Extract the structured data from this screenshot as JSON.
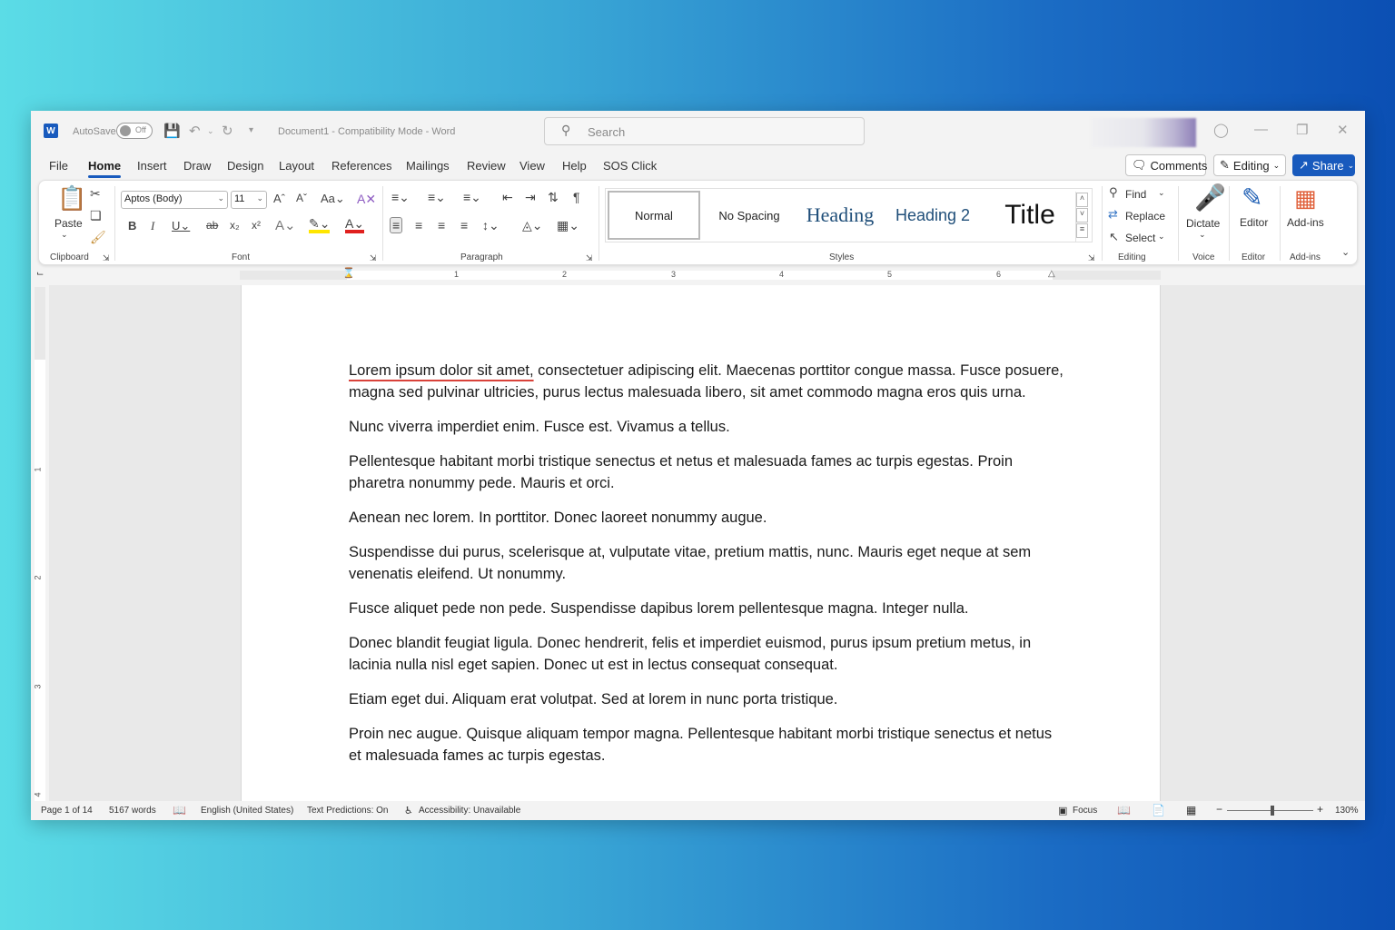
{
  "titlebar": {
    "autosave_label": "AutoSave",
    "autosave_state": "Off",
    "doc_title": "Document1  -  Compatibility Mode  -  Word",
    "search_placeholder": "Search"
  },
  "menu": {
    "tabs": [
      "File",
      "Home",
      "Insert",
      "Draw",
      "Design",
      "Layout",
      "References",
      "Mailings",
      "Review",
      "View",
      "Help",
      "SOS Click"
    ],
    "active_tab": "Home",
    "comments_label": "Comments",
    "editing_label": "Editing",
    "share_label": "Share"
  },
  "ribbon": {
    "clipboard": {
      "paste_label": "Paste",
      "group_label": "Clipboard"
    },
    "font": {
      "font_name": "Aptos (Body)",
      "font_size": "11",
      "group_label": "Font"
    },
    "paragraph": {
      "group_label": "Paragraph"
    },
    "styles": {
      "items": [
        "Normal",
        "No Spacing",
        "Heading 1",
        "Heading 2",
        "Title"
      ],
      "h1_visible": "Heading",
      "group_label": "Styles"
    },
    "editing": {
      "find": "Find",
      "replace": "Replace",
      "select": "Select",
      "group_label": "Editing"
    },
    "voice": {
      "dictate": "Dictate",
      "group_label": "Voice"
    },
    "editor": {
      "label": "Editor",
      "group_label": "Editor"
    },
    "addins": {
      "label": "Add-ins",
      "group_label": "Add-ins"
    }
  },
  "ruler": {
    "h_numbers": [
      "1",
      "2",
      "3",
      "4",
      "5",
      "6"
    ],
    "v_numbers": [
      "1",
      "2",
      "3",
      "4"
    ]
  },
  "document": {
    "first_underlined": "Lorem ipsum dolor sit amet,",
    "first_rest": " consectetuer adipiscing elit. Maecenas porttitor congue massa. Fusce posuere, magna sed pulvinar ultricies, purus lectus malesuada libero, sit amet commodo magna eros quis urna.",
    "paragraphs": [
      "Nunc viverra imperdiet enim. Fusce est. Vivamus a tellus.",
      "Pellentesque habitant morbi tristique senectus et netus et malesuada fames ac turpis egestas. Proin pharetra nonummy pede. Mauris et orci.",
      "Aenean nec lorem. In porttitor. Donec laoreet nonummy augue.",
      "Suspendisse dui purus, scelerisque at, vulputate vitae, pretium mattis, nunc. Mauris eget neque at sem venenatis eleifend. Ut nonummy.",
      "Fusce aliquet pede non pede. Suspendisse dapibus lorem pellentesque magna. Integer nulla.",
      "Donec blandit feugiat ligula. Donec hendrerit, felis et imperdiet euismod, purus ipsum pretium metus, in lacinia nulla nisl eget sapien. Donec ut est in lectus consequat consequat.",
      "Etiam eget dui. Aliquam erat volutpat. Sed at lorem in nunc porta tristique.",
      "Proin nec augue. Quisque aliquam tempor magna. Pellentesque habitant morbi tristique senectus et netus et malesuada fames ac turpis egestas."
    ]
  },
  "status": {
    "page": "Page 1 of 14",
    "words": "5167 words",
    "language": "English (United States)",
    "text_predictions": "Text Predictions: On",
    "accessibility": "Accessibility: Unavailable",
    "focus": "Focus",
    "zoom": "130%"
  },
  "colors": {
    "accent": "#185abd",
    "spell_underline": "#d9423a"
  }
}
